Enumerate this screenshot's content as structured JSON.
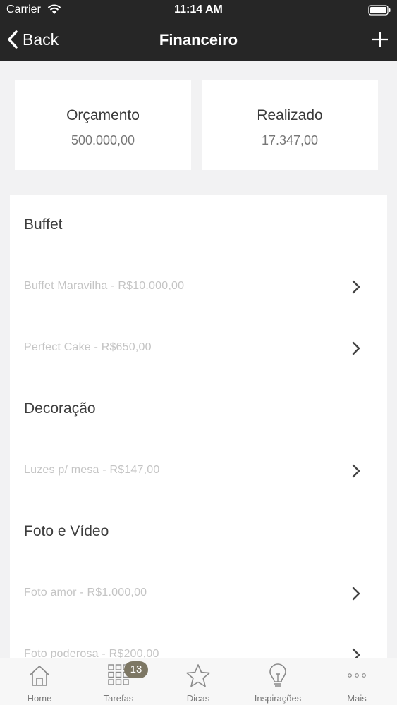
{
  "status_bar": {
    "carrier": "Carrier",
    "time": "11:14 AM"
  },
  "nav": {
    "back_label": "Back",
    "title": "Financeiro"
  },
  "summary": {
    "budget": {
      "label": "Orçamento",
      "value": "500.000,00"
    },
    "spent": {
      "label": "Realizado",
      "value": "17.347,00"
    }
  },
  "sections": [
    {
      "title": "Buffet",
      "items": [
        {
          "label": "Buffet Maravilha - R$10.000,00"
        },
        {
          "label": "Perfect Cake - R$650,00"
        }
      ]
    },
    {
      "title": "Decoração",
      "items": [
        {
          "label": "Luzes p/ mesa - R$147,00"
        }
      ]
    },
    {
      "title": "Foto e Vídeo",
      "items": [
        {
          "label": "Foto amor - R$1.000,00"
        },
        {
          "label": "Foto poderosa - R$200,00"
        }
      ]
    }
  ],
  "tabs": [
    {
      "label": "Home",
      "icon": "home-icon"
    },
    {
      "label": "Tarefas",
      "icon": "grid-icon",
      "badge": "13"
    },
    {
      "label": "Dicas",
      "icon": "star-icon"
    },
    {
      "label": "Inspirações",
      "icon": "lightbulb-icon"
    },
    {
      "label": "Mais",
      "icon": "more-icon"
    }
  ],
  "colors": {
    "header_bg": "#262626",
    "badge_bg": "#7d7764",
    "page_bg": "#f2f2f3"
  }
}
